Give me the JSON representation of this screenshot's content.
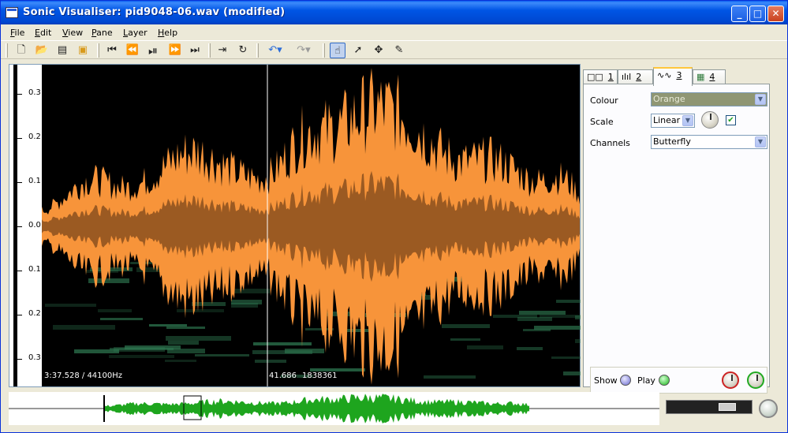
{
  "window": {
    "title": "Sonic Visualiser: pid9048-06.wav (modified)",
    "minimize": "_",
    "maximize": "□",
    "close": "✕"
  },
  "menu": [
    "File",
    "Edit",
    "View",
    "Pane",
    "Layer",
    "Help"
  ],
  "toolbar": {
    "icons": [
      "new-file-icon",
      "open-file-icon",
      "save-icon",
      "save-session-icon",
      "rewind-start-icon",
      "rewind-icon",
      "play-pause-icon",
      "fast-forward-icon",
      "fast-forward-end-icon",
      "play-selection-icon",
      "loop-icon",
      "undo-icon",
      "redo-icon",
      "navigate-tool-icon",
      "select-tool-icon",
      "move-tool-icon",
      "draw-tool-icon"
    ]
  },
  "pane": {
    "scale_ticks": [
      "0.3",
      "0.2",
      "0.1",
      "0.0",
      "0.1",
      "0.2",
      "0.3"
    ],
    "time_readout": "3:37.528 / 44100Hz",
    "frame_left": "41.686",
    "frame_right": "1838361"
  },
  "properties": {
    "tabs": [
      {
        "glyph": "□□",
        "label": "1"
      },
      {
        "glyph": "ılıl",
        "label": "2"
      },
      {
        "glyph": "∿∿",
        "label": "3"
      },
      {
        "glyph": "▦",
        "label": "4"
      }
    ],
    "selected_tab": "3",
    "colour_label": "Colour",
    "colour_value": "Orange",
    "scale_label": "Scale",
    "scale_value": "Linear",
    "scale_checked": true,
    "channels_label": "Channels",
    "channels_value": "Butterfly",
    "show_label": "Show",
    "play_label": "Play"
  },
  "colors": {
    "waveform": "#f7943a",
    "waveform_inner": "#9b5a22",
    "spectrogram_band": "#2f7a52",
    "overview_wave": "#1ea51e"
  }
}
